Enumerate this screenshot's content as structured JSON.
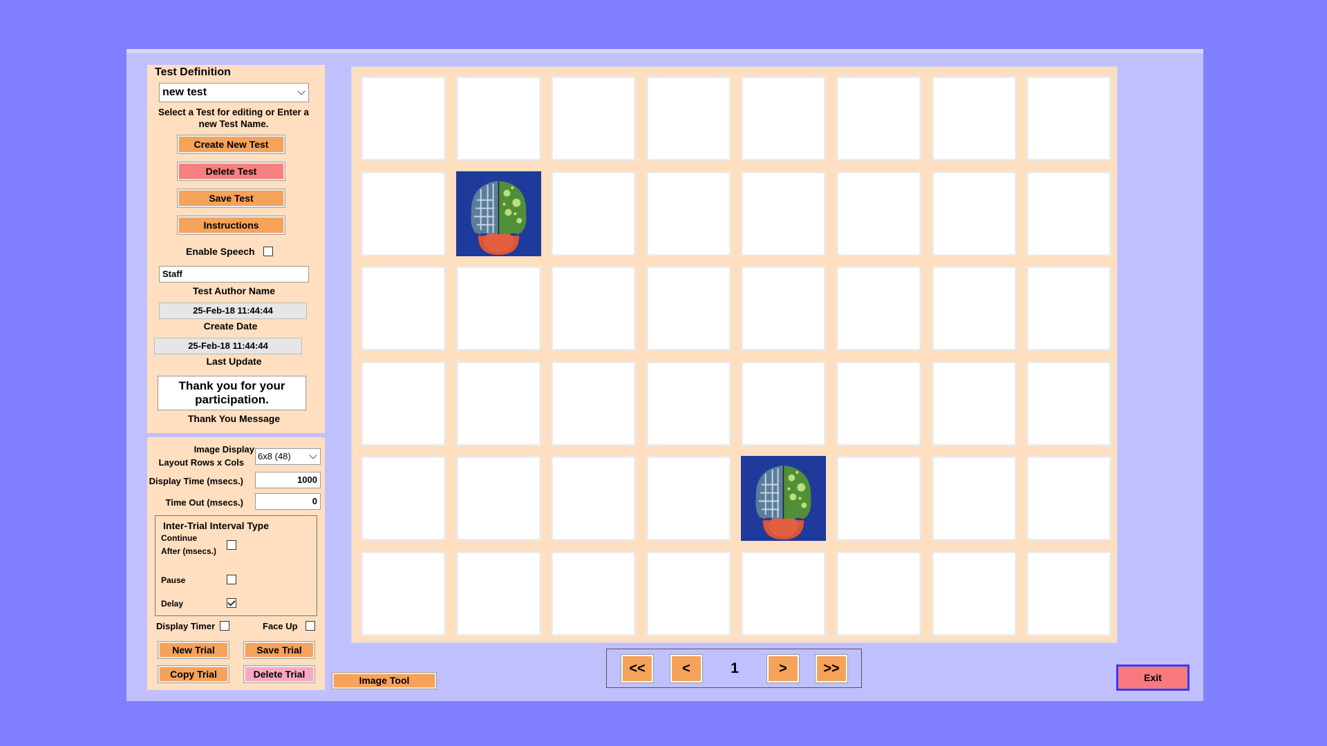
{
  "test_definition": {
    "title": "Test Definition",
    "test_select_value": "new test",
    "hint": "Select a Test for editing or Enter a new Test Name.",
    "create_label": "Create New Test",
    "delete_label": "Delete Test",
    "save_label": "Save Test",
    "instructions_label": "Instructions",
    "enable_speech_label": "Enable Speech",
    "enable_speech_checked": false,
    "author_value": "Staff",
    "author_label": "Test Author Name",
    "create_date_value": "25-Feb-18 11:44:44",
    "create_date_label": "Create Date",
    "last_update_value": "25-Feb-18 11:44:44",
    "last_update_label": "Last Update",
    "thank_you_value": "Thank you for your participation.",
    "thank_you_label": "Thank You Message"
  },
  "trial_settings": {
    "layout_label_1": "Image Display",
    "layout_label_2": "Layout Rows x Cols",
    "layout_value": "6x8 (48)",
    "display_time_label": "Display Time (msecs.)",
    "display_time_value": "1000",
    "timeout_label": "Time Out (msecs.)",
    "timeout_value": "0",
    "iti_title": "Inter-Trial Interval Type",
    "continue_label_1": "Continue",
    "continue_label_2": "After (msecs.)",
    "continue_checked": false,
    "pause_label": "Pause",
    "pause_checked": false,
    "delay_label": "Delay",
    "delay_checked": true,
    "display_timer_label": "Display Timer",
    "display_timer_checked": false,
    "face_up_label": "Face Up",
    "face_up_checked": false,
    "new_trial_label": "New Trial",
    "save_trial_label": "Save Trial",
    "copy_trial_label": "Copy Trial",
    "delete_trial_label": "Delete Trial"
  },
  "image_tool_label": "Image Tool",
  "grid": {
    "rows": 6,
    "cols": 8,
    "image_cells": [
      [
        1,
        1
      ],
      [
        4,
        4
      ]
    ],
    "image_icon": "brain-head-image"
  },
  "pager": {
    "first_label": "<<",
    "prev_label": "<",
    "page": "1",
    "next_label": ">",
    "last_label": ">>"
  },
  "exit_label": "Exit",
  "colors": {
    "background": "#8080ff",
    "window": "#c0c0ff",
    "panel": "#ffdfbf",
    "button": "#f5a25a",
    "danger": "#f78080"
  }
}
